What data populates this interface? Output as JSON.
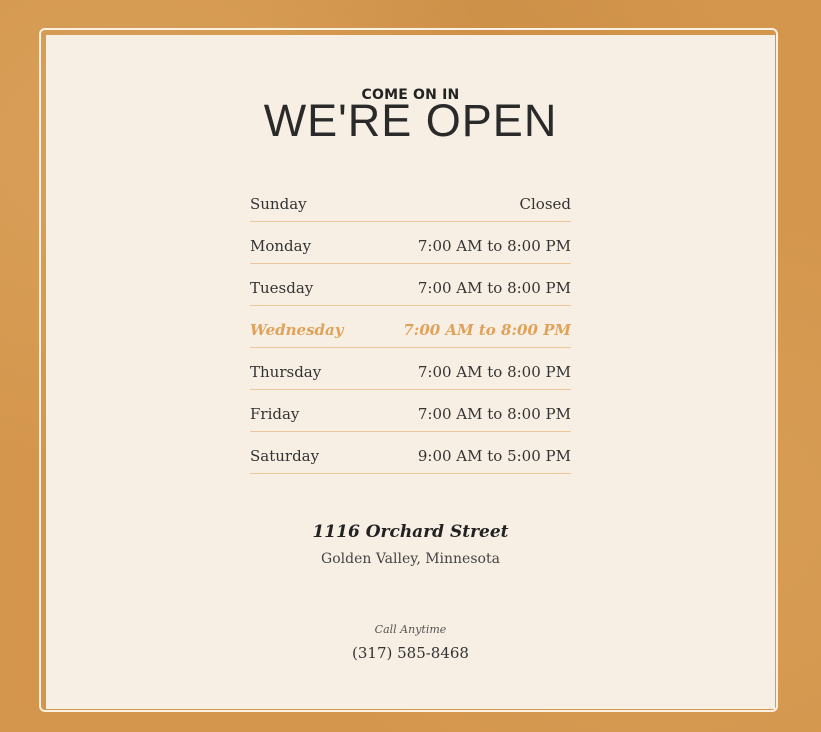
{
  "header": {
    "eyebrow": "COME ON IN",
    "title": "WE'RE OPEN"
  },
  "hours": [
    {
      "day": "Sunday",
      "time": "Closed",
      "today": false
    },
    {
      "day": "Monday",
      "time": "7:00 AM to 8:00 PM",
      "today": false
    },
    {
      "day": "Tuesday",
      "time": "7:00 AM to 8:00 PM",
      "today": false
    },
    {
      "day": "Wednesday",
      "time": "7:00 AM to 8:00 PM",
      "today": true
    },
    {
      "day": "Thursday",
      "time": "7:00 AM to 8:00 PM",
      "today": false
    },
    {
      "day": "Friday",
      "time": "7:00 AM to 8:00 PM",
      "today": false
    },
    {
      "day": "Saturday",
      "time": "9:00 AM to 5:00 PM",
      "today": false
    }
  ],
  "location": {
    "street": "1116 Orchard Street",
    "city": "Golden Valley, Minnesota"
  },
  "contact": {
    "label": "Call Anytime",
    "phone": "(317) 585-8468"
  },
  "colors": {
    "background": "#d4964c",
    "card": "#f7efe3",
    "highlight": "#e0a25a",
    "divider": "#ebc79a"
  }
}
